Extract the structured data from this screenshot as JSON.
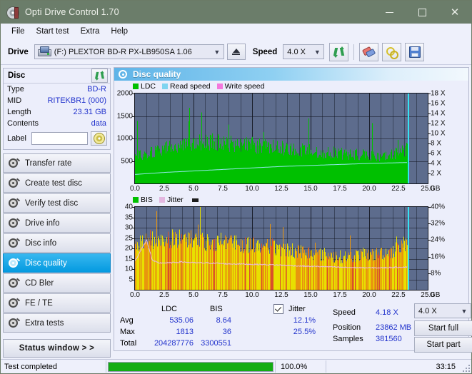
{
  "window": {
    "title": "Opti Drive Control 1.70",
    "icon": "disc-icon",
    "minimize": "–",
    "maximize": "□",
    "close": "✕"
  },
  "menubar": {
    "items": [
      {
        "label": "File",
        "name": "menu-file"
      },
      {
        "label": "Start test",
        "name": "menu-start-test"
      },
      {
        "label": "Extra",
        "name": "menu-extra"
      },
      {
        "label": "Help",
        "name": "menu-help"
      }
    ]
  },
  "toolbar": {
    "drive_label": "Drive",
    "drive_value": "(F:)   PLEXTOR BD-R  PX-LB950SA 1.06",
    "eject_icon": "eject-icon",
    "speed_label": "Speed",
    "speed_value": "4.0 X",
    "refresh_icon": "refresh-icon",
    "eraser_icon": "eraser-icon",
    "key_icon": "key-icon",
    "save_icon": "save-icon"
  },
  "disc_panel": {
    "title": "Disc",
    "refresh_icon": "refresh-icon",
    "rows": [
      {
        "key": "Type",
        "value": "BD-R"
      },
      {
        "key": "MID",
        "value": "RITEKBR1 (000)"
      },
      {
        "key": "Length",
        "value": "23.31 GB"
      },
      {
        "key": "Contents",
        "value": "data"
      }
    ],
    "label_key": "Label",
    "label_value": "",
    "label_placeholder": "",
    "cd_icon": "cd-icon"
  },
  "sidebar": {
    "items": [
      {
        "label": "Transfer rate",
        "name": "sidebar-item-transfer-rate",
        "active": false
      },
      {
        "label": "Create test disc",
        "name": "sidebar-item-create-test-disc",
        "active": false
      },
      {
        "label": "Verify test disc",
        "name": "sidebar-item-verify-test-disc",
        "active": false
      },
      {
        "label": "Drive info",
        "name": "sidebar-item-drive-info",
        "active": false
      },
      {
        "label": "Disc info",
        "name": "sidebar-item-disc-info",
        "active": false
      },
      {
        "label": "Disc quality",
        "name": "sidebar-item-disc-quality",
        "active": true
      },
      {
        "label": "CD Bler",
        "name": "sidebar-item-cd-bler",
        "active": false
      },
      {
        "label": "FE / TE",
        "name": "sidebar-item-fe-te",
        "active": false
      },
      {
        "label": "Extra tests",
        "name": "sidebar-item-extra-tests",
        "active": false
      }
    ],
    "status_window_button": "Status window > >"
  },
  "panel": {
    "title": "Disc quality",
    "icon": "cd-icon"
  },
  "chart_data": [
    {
      "type": "area",
      "name": "ldc-chart",
      "title": "",
      "xlabel": "GB",
      "ylabel": "",
      "xlim": [
        0.0,
        25.0
      ],
      "ylim": [
        0,
        2000
      ],
      "y2lim": [
        0,
        18
      ],
      "y2label": "X",
      "grid": true,
      "legend_position": "top-left",
      "legend": [
        {
          "label": "LDC",
          "color": "#00c000"
        },
        {
          "label": "Read speed",
          "color": "#7ed4f0"
        },
        {
          "label": "Write speed",
          "color": "#f478dd"
        }
      ],
      "xticks": [
        "0.0",
        "2.5",
        "5.0",
        "7.5",
        "10.0",
        "12.5",
        "15.0",
        "17.5",
        "20.0",
        "22.5",
        "25.0"
      ],
      "yticks": [
        "500",
        "1000",
        "1500",
        "2000"
      ],
      "y2ticks": [
        "2 X",
        "4 X",
        "6 X",
        "8 X",
        "10 X",
        "12 X",
        "14 X",
        "16 X",
        "18 X"
      ],
      "cursor_x_gb": 23.3,
      "series": [
        {
          "name": "LDC",
          "color": "#00c000",
          "kind": "area",
          "x": [
            0.0,
            0.5,
            1.0,
            1.5,
            2.0,
            2.5,
            3.0,
            3.5,
            4.0,
            4.5,
            5.0,
            5.5,
            6.0,
            6.5,
            7.0,
            7.5,
            8.0,
            8.5,
            9.0,
            9.5,
            10.0,
            10.5,
            11.0,
            11.5,
            12.0,
            12.5,
            13.0,
            13.5,
            14.0,
            14.5,
            15.0,
            15.5,
            16.0,
            16.5,
            17.0,
            17.5,
            18.0,
            18.5,
            19.0,
            19.5,
            20.0,
            20.5,
            21.0,
            21.5,
            22.0,
            22.5,
            23.0,
            23.3
          ],
          "values": [
            620,
            640,
            660,
            700,
            720,
            760,
            790,
            820,
            850,
            870,
            900,
            910,
            920,
            930,
            920,
            900,
            880,
            870,
            860,
            850,
            840,
            830,
            820,
            810,
            800,
            790,
            780,
            770,
            760,
            740,
            730,
            720,
            700,
            690,
            680,
            670,
            660,
            650,
            640,
            630,
            620,
            620,
            610,
            610,
            640,
            680,
            720,
            780
          ]
        },
        {
          "name": "Read speed",
          "color": "#8fe8e8",
          "kind": "line",
          "x": [
            0.0,
            2.5,
            5.0,
            7.5,
            10.0,
            12.5,
            15.0,
            17.5,
            20.0,
            22.5,
            23.3
          ],
          "values": [
            1.8,
            2.2,
            2.5,
            2.8,
            3.1,
            3.4,
            3.6,
            3.8,
            4.0,
            4.15,
            4.18
          ]
        },
        {
          "name": "Write speed",
          "color": "#f478dd",
          "kind": "line",
          "x": [],
          "values": []
        }
      ]
    },
    {
      "type": "area",
      "name": "bis-jitter-chart",
      "title": "",
      "xlabel": "GB",
      "ylabel": "",
      "xlim": [
        0.0,
        25.0
      ],
      "ylim": [
        0,
        40
      ],
      "y2lim": [
        0,
        40
      ],
      "y2label": "%",
      "grid": true,
      "legend_position": "top-left",
      "legend": [
        {
          "label": "BIS",
          "color": "#00c000"
        },
        {
          "label": "Jitter",
          "color": "#e3b7e0"
        }
      ],
      "xticks": [
        "0.0",
        "2.5",
        "5.0",
        "7.5",
        "10.0",
        "12.5",
        "15.0",
        "17.5",
        "20.0",
        "22.5",
        "25.0"
      ],
      "yticks": [
        "5",
        "10",
        "15",
        "20",
        "25",
        "30",
        "35",
        "40"
      ],
      "y2ticks": [
        "8%",
        "16%",
        "24%",
        "32%",
        "40%"
      ],
      "cursor_x_gb": 23.3,
      "series": [
        {
          "name": "BIS",
          "color": "#e8b000",
          "kind": "area",
          "x": [
            0.0,
            0.5,
            1.0,
            1.5,
            2.0,
            2.5,
            3.0,
            3.5,
            4.0,
            4.5,
            5.0,
            5.5,
            6.0,
            6.5,
            7.0,
            7.5,
            8.0,
            8.5,
            9.0,
            9.5,
            10.0,
            10.5,
            11.0,
            11.5,
            12.0,
            12.5,
            13.0,
            13.5,
            14.0,
            14.5,
            15.0,
            15.5,
            16.0,
            16.5,
            17.0,
            17.5,
            18.0,
            18.5,
            19.0,
            19.5,
            20.0,
            20.5,
            21.0,
            21.5,
            22.0,
            22.5,
            23.0,
            23.3
          ],
          "values": [
            22,
            24,
            25,
            24,
            23,
            24,
            24,
            25,
            24,
            24,
            25,
            24,
            23,
            23,
            23,
            24,
            24,
            23,
            22,
            22,
            22,
            21,
            21,
            21,
            20,
            20,
            19,
            19,
            19,
            18,
            18,
            17,
            17,
            17,
            16,
            16,
            16,
            16,
            17,
            17,
            17,
            17,
            18,
            18,
            19,
            20,
            22,
            26
          ]
        },
        {
          "name": "Jitter",
          "color": "#e8bde4",
          "kind": "line",
          "x": [
            0.0,
            0.5,
            1.0,
            1.5,
            2.0,
            3.0,
            4.0,
            5.0,
            6.0,
            7.0,
            8.0,
            9.0,
            10.0,
            11.0,
            12.0,
            13.0,
            14.0,
            15.0,
            16.0,
            17.0,
            18.0,
            19.0,
            20.0,
            21.0,
            22.0,
            23.0,
            23.3
          ],
          "values": [
            14,
            19,
            24,
            14,
            13,
            13,
            13.5,
            13,
            13,
            12.8,
            12.5,
            12.5,
            12.3,
            12.2,
            12,
            11.8,
            11.5,
            11.3,
            11.2,
            11,
            10.8,
            10.7,
            10.6,
            10.6,
            10.8,
            11,
            11
          ]
        }
      ]
    }
  ],
  "stats": {
    "col_headers": [
      "LDC",
      "BIS"
    ],
    "jitter_label": "Jitter",
    "jitter_checked": true,
    "rows": [
      {
        "label": "Avg",
        "ldc": "535.06",
        "bis": "8.64",
        "jitter": "12.1%"
      },
      {
        "label": "Max",
        "ldc": "1813",
        "bis": "36",
        "jitter": "25.5%"
      },
      {
        "label": "Total",
        "ldc": "204287776",
        "bis": "3300551",
        "jitter": ""
      }
    ],
    "speed_label": "Speed",
    "speed_value": "4.18 X",
    "position_label": "Position",
    "position_value": "23862 MB",
    "samples_label": "Samples",
    "samples_value": "381560",
    "speed_select": "4.0 X",
    "start_full_button": "Start full",
    "start_part_button": "Start part"
  },
  "statusbar": {
    "message": "Test completed",
    "progress_percent": 100.0,
    "progress_text": "100.0%",
    "elapsed": "33:15"
  },
  "colors": {
    "titlebar": "#6b7d6a",
    "accent": "#049ae0",
    "plot_bg": "#5d6c8d",
    "ldc_green": "#00c000",
    "bis_amber": "#e8b000",
    "jitter_pink": "#e8bde4",
    "read_speed_cyan": "#8fe8e8",
    "progress_green": "#13ad13",
    "value_blue": "#2233cc"
  }
}
